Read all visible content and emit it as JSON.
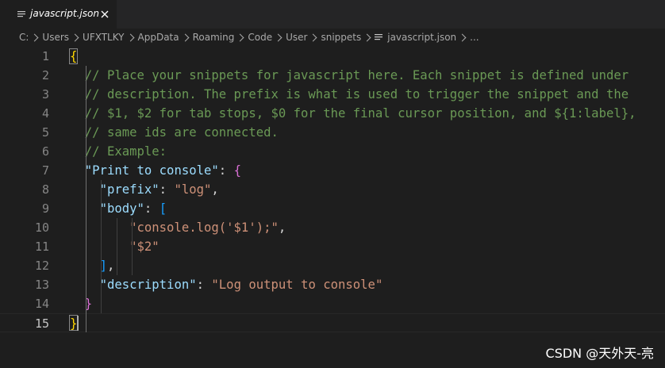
{
  "tab": {
    "label": "javascript.json",
    "icon": "json-file-icon",
    "close_icon": "close-icon"
  },
  "breadcrumb": {
    "items": [
      "C:",
      "Users",
      "UFXTLKY",
      "AppData",
      "Roaming",
      "Code",
      "User",
      "snippets",
      "javascript.json",
      "..."
    ]
  },
  "editor": {
    "current_line": 15,
    "lines": [
      {
        "n": "1",
        "segs": [
          [
            "{",
            "b1"
          ]
        ]
      },
      {
        "n": "2",
        "segs": [
          [
            "  // Place your snippets for javascript here. Each snippet is defined under",
            "comment"
          ]
        ]
      },
      {
        "n": "3",
        "segs": [
          [
            "  // description. The prefix is what is used to trigger the snippet and the",
            "comment"
          ]
        ]
      },
      {
        "n": "4",
        "segs": [
          [
            "  // $1, $2 for tab stops, $0 for the final cursor position, and ${1:label},",
            "comment"
          ]
        ]
      },
      {
        "n": "5",
        "segs": [
          [
            "  // same ids are connected.",
            "comment"
          ]
        ]
      },
      {
        "n": "6",
        "segs": [
          [
            "  // Example:",
            "comment"
          ]
        ]
      },
      {
        "n": "7",
        "segs": [
          [
            "  ",
            "punct"
          ],
          [
            "\"Print to console\"",
            "key"
          ],
          [
            ": ",
            "punct"
          ],
          [
            "{",
            "b2"
          ]
        ]
      },
      {
        "n": "8",
        "segs": [
          [
            "    ",
            "punct"
          ],
          [
            "\"prefix\"",
            "key"
          ],
          [
            ": ",
            "punct"
          ],
          [
            "\"log\"",
            "str"
          ],
          [
            ",",
            "punct"
          ]
        ]
      },
      {
        "n": "9",
        "segs": [
          [
            "    ",
            "punct"
          ],
          [
            "\"body\"",
            "key"
          ],
          [
            ": ",
            "punct"
          ],
          [
            "[",
            "b3"
          ]
        ]
      },
      {
        "n": "10",
        "segs": [
          [
            "        ",
            "punct"
          ],
          [
            "\"console.log('$1');\"",
            "str"
          ],
          [
            ",",
            "punct"
          ]
        ]
      },
      {
        "n": "11",
        "segs": [
          [
            "        ",
            "punct"
          ],
          [
            "\"$2\"",
            "str"
          ]
        ]
      },
      {
        "n": "12",
        "segs": [
          [
            "    ",
            "punct"
          ],
          [
            "]",
            "b3"
          ],
          [
            ",",
            "punct"
          ]
        ]
      },
      {
        "n": "13",
        "segs": [
          [
            "    ",
            "punct"
          ],
          [
            "\"description\"",
            "key"
          ],
          [
            ": ",
            "punct"
          ],
          [
            "\"Log output to console\"",
            "str"
          ]
        ]
      },
      {
        "n": "14",
        "segs": [
          [
            "  ",
            "punct"
          ],
          [
            "}",
            "b2"
          ]
        ]
      },
      {
        "n": "15",
        "segs": [
          [
            "}",
            "b1"
          ]
        ]
      }
    ]
  },
  "watermark": "CSDN @天外天-亮",
  "colors": {
    "comment": "#6a9955",
    "key": "#9cdcfe",
    "string": "#ce9178",
    "bracket_level1": "#ffd700",
    "bracket_level2": "#da70d6",
    "bracket_level3": "#179fff",
    "background": "#1e1e1e"
  }
}
